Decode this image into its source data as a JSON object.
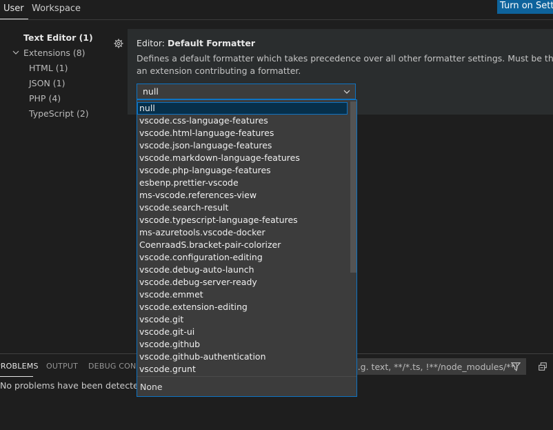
{
  "tabs": {
    "user": "User",
    "workspace": "Workspace"
  },
  "sync_button": "Turn on Settings Sync",
  "toc": [
    {
      "label": "Text Editor (1)",
      "bold": true,
      "expanded": false
    },
    {
      "label": "Extensions (8)",
      "bold": false,
      "expanded": true
    },
    {
      "label": "HTML (1)"
    },
    {
      "label": "JSON (1)"
    },
    {
      "label": "PHP (4)"
    },
    {
      "label": "TypeScript (2)"
    }
  ],
  "setting": {
    "category": "Editor: ",
    "name": "Default Formatter",
    "description_line1": "Defines a default formatter which takes precedence over all other formatter settings. Must be the identifier of",
    "description_line2": "an extension contributing a formatter.",
    "value": "null"
  },
  "dropdown": {
    "options": [
      "null",
      "vscode.css-language-features",
      "vscode.html-language-features",
      "vscode.json-language-features",
      "vscode.markdown-language-features",
      "vscode.php-language-features",
      "esbenp.prettier-vscode",
      "ms-vscode.references-view",
      "vscode.search-result",
      "vscode.typescript-language-features",
      "ms-azuretools.vscode-docker",
      "CoenraadS.bracket-pair-colorizer",
      "vscode.configuration-editing",
      "vscode.debug-auto-launch",
      "vscode.debug-server-ready",
      "vscode.emmet",
      "vscode.extension-editing",
      "vscode.git",
      "vscode.git-ui",
      "vscode.github",
      "vscode.github-authentication",
      "vscode.grunt"
    ],
    "selected_index": 0,
    "option_description": "None"
  },
  "panel": {
    "tabs": [
      "PROBLEMS",
      "OUTPUT",
      "DEBUG CONSOLE"
    ],
    "filter_text": "e.g. text, **/*.ts, !**/node_modules/**)",
    "message": "No problems have been detected in the workspace."
  },
  "colors": {
    "accent": "#0e639c",
    "focus_border": "#0e74c4",
    "background": "#1e1e1e"
  }
}
